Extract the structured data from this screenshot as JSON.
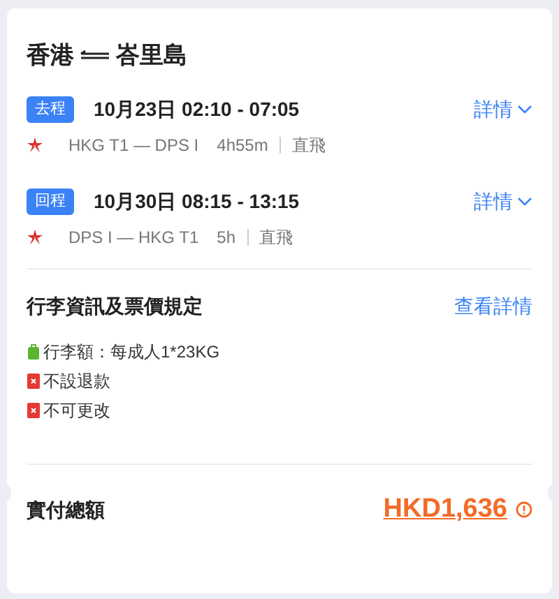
{
  "title": {
    "from": "香港",
    "to": "峇里島"
  },
  "legs": [
    {
      "badge": "去程",
      "datetime": "10月23日 02:10 - 07:05",
      "details": "詳情",
      "route": "HKG T1 — DPS I",
      "duration": "4h55m",
      "stops": "直飛"
    },
    {
      "badge": "回程",
      "datetime": "10月30日 08:15 - 13:15",
      "details": "詳情",
      "route": "DPS I — HKG T1",
      "duration": "5h",
      "stops": "直飛"
    }
  ],
  "policy": {
    "heading": "行李資訊及票價規定",
    "link": "查看詳情",
    "items": [
      {
        "kind": "baggage",
        "text": "行李額：每成人1*23KG"
      },
      {
        "kind": "restriction",
        "text": "不設退款"
      },
      {
        "kind": "restriction",
        "text": "不可更改"
      }
    ]
  },
  "total": {
    "label": "實付總額",
    "amount": "HKD1,636"
  }
}
